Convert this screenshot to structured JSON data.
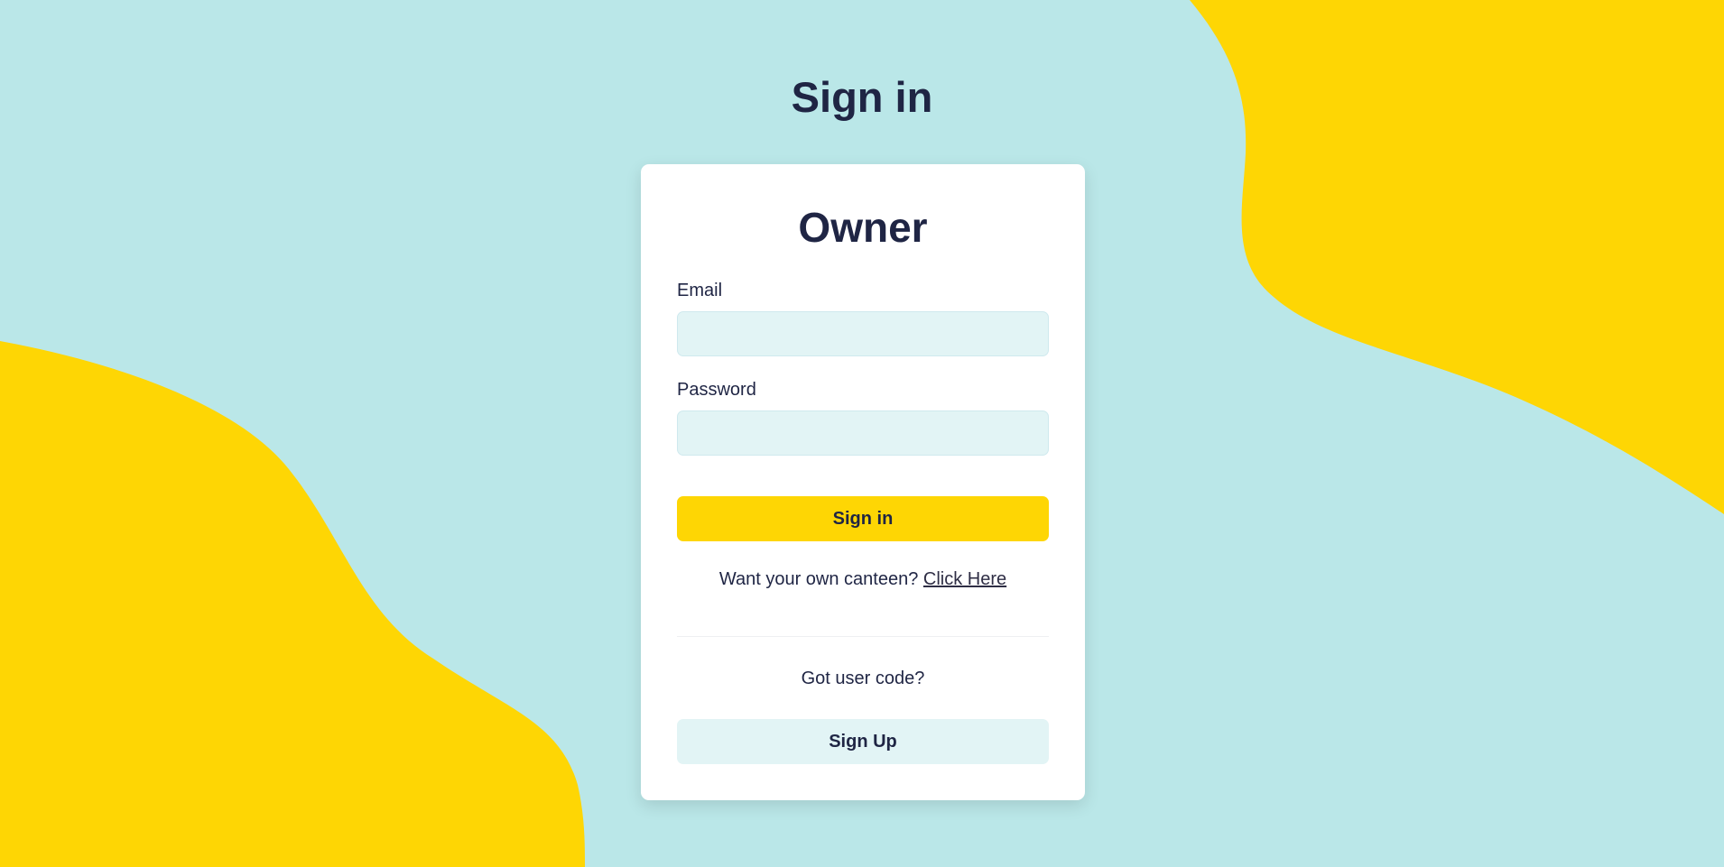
{
  "page": {
    "title": "Sign in"
  },
  "colors": {
    "background": "#bae7e8",
    "blob": "#fed604",
    "card": "#ffffff",
    "text": "#1f2544",
    "input_bg": "#e2f4f5",
    "primary_button": "#fed604",
    "secondary_button": "#e2f4f5"
  },
  "card": {
    "heading": "Owner",
    "email": {
      "label": "Email",
      "value": "",
      "placeholder": ""
    },
    "password": {
      "label": "Password",
      "value": "",
      "placeholder": ""
    },
    "sign_in_label": "Sign in",
    "promo_text": "Want your own canteen? ",
    "promo_link": "Click Here",
    "code_question": "Got user code?",
    "sign_up_label": "Sign Up"
  }
}
